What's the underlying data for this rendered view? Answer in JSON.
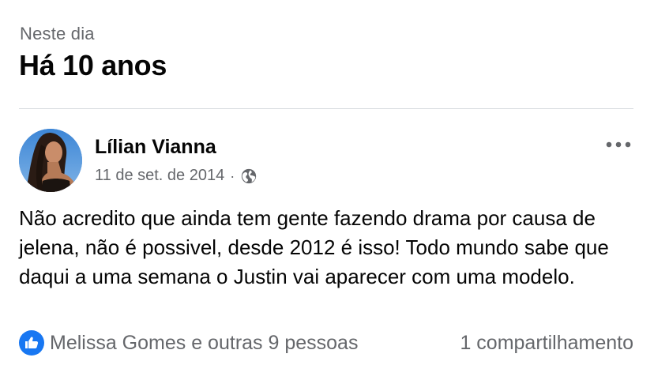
{
  "header": {
    "section_label": "Neste dia",
    "section_title": "Há 10 anos"
  },
  "post": {
    "author": "Lílian Vianna",
    "date": "11 de set. de 2014",
    "separator": "·",
    "privacy_icon": "globe-icon",
    "more_icon": "more-horizontal-icon",
    "text": "Não acredito que ainda tem gente fazendo drama por causa de jelena, não é possivel, desde 2012 é isso! Todo mundo sabe que daqui a uma semana o Justin vai aparecer com uma modelo.",
    "reactions": {
      "icon": "like-icon",
      "summary": "Melissa Gomes e outras 9 pessoas"
    },
    "shares": "1 compartilhamento"
  },
  "colors": {
    "text_primary": "#050505",
    "text_secondary": "#65676b",
    "like_blue": "#1877f2",
    "divider": "#dadde1"
  }
}
